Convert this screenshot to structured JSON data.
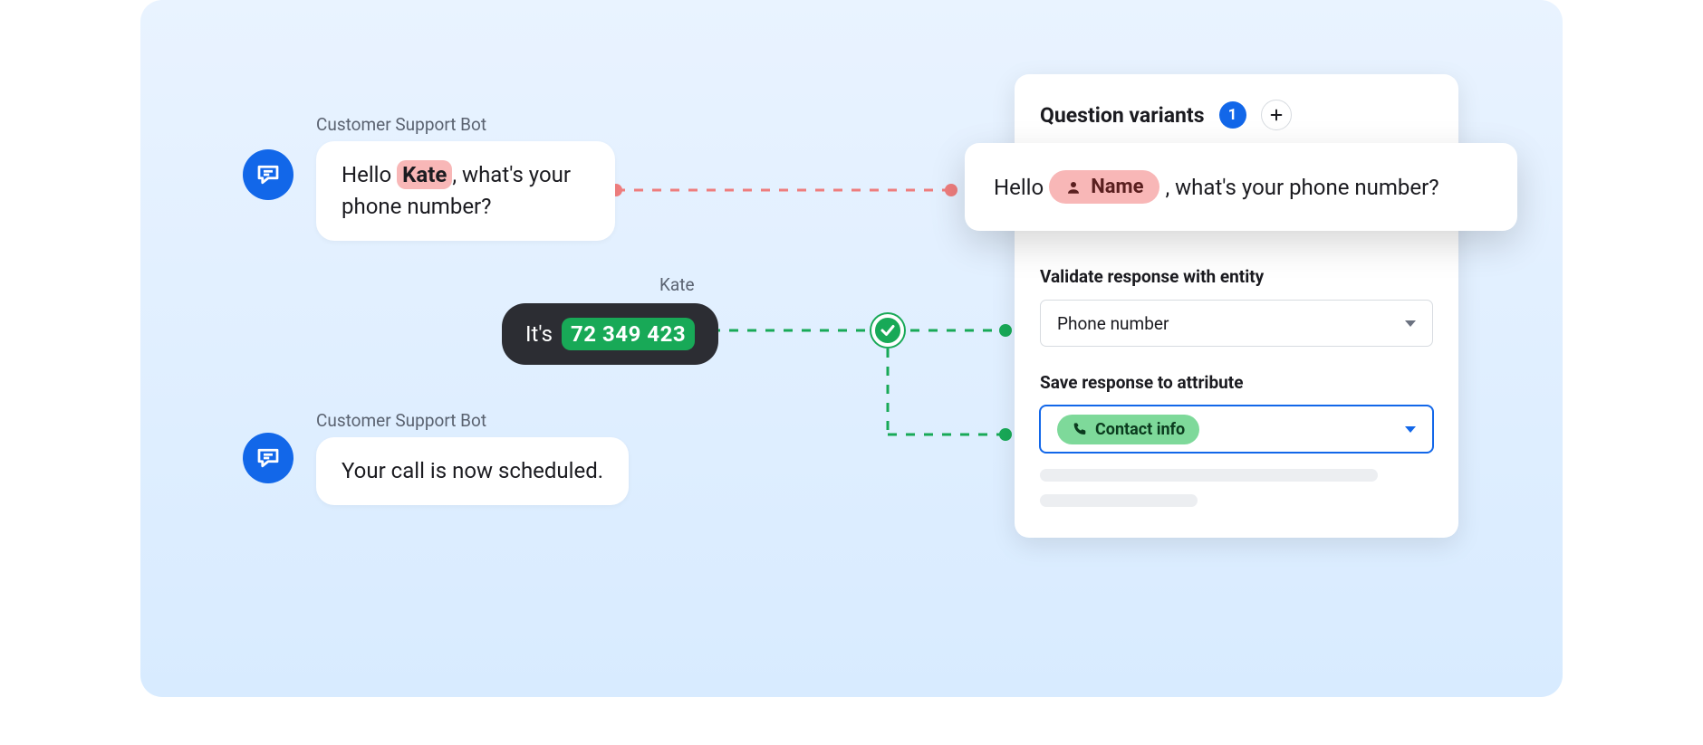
{
  "chat": {
    "bot_name": "Customer Support Bot",
    "user_name": "Kate",
    "msg1_prefix": "Hello ",
    "msg1_highlight": "Kate",
    "msg1_comma": ", ",
    "msg1_rest": "what's your phone number?",
    "msg2_prefix": "It's ",
    "msg2_phone": "72 349 423",
    "msg3": "Your call is now scheduled."
  },
  "panel": {
    "title": "Question variants",
    "count": "1",
    "validate_label": "Validate response with entity",
    "validate_value": "Phone number",
    "save_label": "Save response to attribute",
    "save_value": "Contact info"
  },
  "variant": {
    "prefix": "Hello ",
    "token": "Name",
    "suffix": ", what's your phone number?"
  },
  "colors": {
    "accent_blue": "#1267e9",
    "pink": "#f8b7b7",
    "green": "#18a957",
    "dark": "#2c2d33"
  }
}
